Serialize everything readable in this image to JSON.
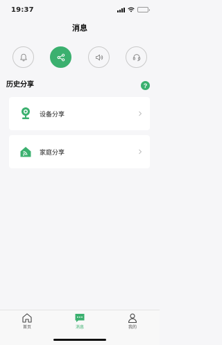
{
  "status_bar": {
    "time": "19:37"
  },
  "nav": {
    "title": "消息"
  },
  "categories": [
    {
      "icon": "bell-icon",
      "active": false
    },
    {
      "icon": "share-icon",
      "active": true
    },
    {
      "icon": "speaker-icon",
      "active": false
    },
    {
      "icon": "headset-icon",
      "active": false
    }
  ],
  "section": {
    "title": "历史分享",
    "help": "?"
  },
  "items": [
    {
      "label": "设备分享",
      "icon": "camera-icon"
    },
    {
      "label": "家庭分享",
      "icon": "home-wifi-icon"
    }
  ],
  "tabs": [
    {
      "label": "首页",
      "icon": "home-icon",
      "active": false
    },
    {
      "label": "消息",
      "icon": "message-icon",
      "active": true
    },
    {
      "label": "我的",
      "icon": "user-icon",
      "active": false
    }
  ],
  "colors": {
    "accent": "#3bb06f",
    "background": "#f6f6f8"
  }
}
